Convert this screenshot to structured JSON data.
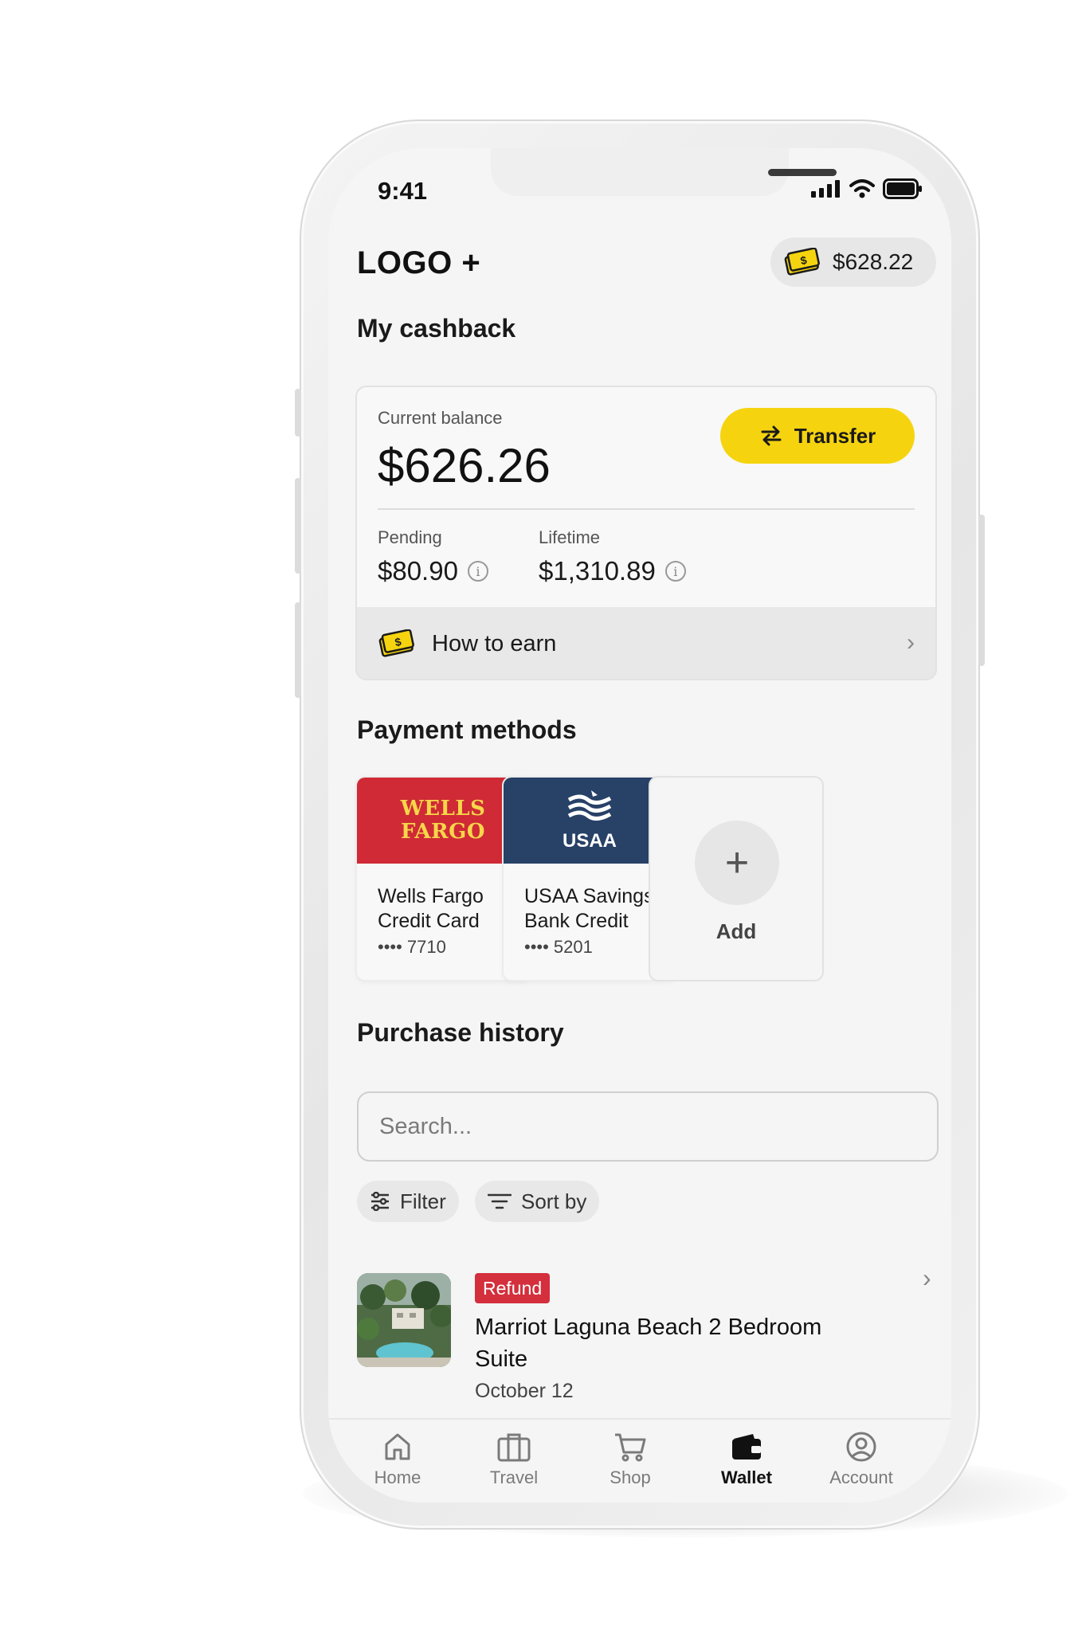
{
  "status_bar": {
    "time": "9:41"
  },
  "header": {
    "logo": "LOGO +",
    "balance": "$628.22"
  },
  "cashback": {
    "title": "My cashback",
    "current_label": "Current balance",
    "current_amount": "$626.26",
    "transfer_label": "Transfer",
    "pending_label": "Pending",
    "pending_amount": "$80.90",
    "lifetime_label": "Lifetime",
    "lifetime_amount": "$1,310.89",
    "how_to_earn": "How to earn"
  },
  "payment_methods": {
    "title": "Payment methods",
    "cards": [
      {
        "logo_line1": "WELLS",
        "logo_line2": "FARGO",
        "name": "Wells Fargo Credit Card",
        "last4": "•••• 7710"
      },
      {
        "logo": "USAA",
        "name": "USAA Savings Bank Credit",
        "last4": "•••• 5201"
      }
    ],
    "add_label": "Add"
  },
  "purchase_history": {
    "title": "Purchase history",
    "search_placeholder": "Search...",
    "filter_label": "Filter",
    "sort_label": "Sort by",
    "items": [
      {
        "badge": "Refund",
        "title": "Marriot Laguna Beach 2 Bedroom Suite",
        "date": "October 12"
      }
    ]
  },
  "tabbar": {
    "items": [
      {
        "label": "Home",
        "icon": "home-icon"
      },
      {
        "label": "Travel",
        "icon": "briefcase-icon"
      },
      {
        "label": "Shop",
        "icon": "cart-icon"
      },
      {
        "label": "Wallet",
        "icon": "wallet-icon",
        "active": true
      },
      {
        "label": "Account",
        "icon": "account-icon"
      }
    ]
  },
  "colors": {
    "accent_yellow": "#f5d40f",
    "refund_red": "#d32f3c",
    "wells_fargo_red": "#cf2a35",
    "usaa_navy": "#274167"
  }
}
